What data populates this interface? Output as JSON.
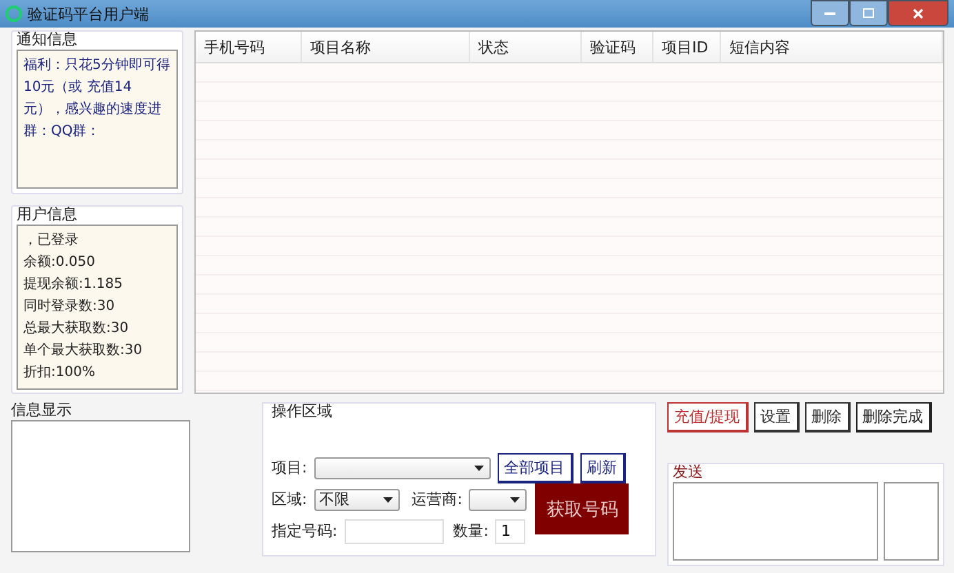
{
  "window": {
    "title": "验证码平台用户端"
  },
  "notice": {
    "label": "通知信息",
    "text": "福利：只花5分钟即可得10元（或 充值14元），感兴趣的速度进群：QQ群："
  },
  "user_info": {
    "label": "用户信息",
    "lines": [
      "，已登录",
      "余额:0.050",
      "提现余额:1.185",
      "同时登录数:30",
      "总最大获取数:30",
      "单个最大获取数:30",
      "折扣:100%"
    ]
  },
  "table": {
    "columns": [
      "手机号码",
      "项目名称",
      "状态",
      "验证码",
      "项目ID",
      "短信内容"
    ]
  },
  "message": {
    "label": "信息显示"
  },
  "operations": {
    "label": "操作区域",
    "project_label": "项目:",
    "all_projects": "全部项目",
    "refresh": "刷新",
    "region_label": "区域:",
    "region_value": "不限",
    "carrier_label": "运营商:",
    "number_label": "指定号码:",
    "count_label": "数量:",
    "count_value": "1",
    "get_number": "获取号码"
  },
  "actions": [
    {
      "label": "充值/提现",
      "kind": "accent"
    },
    {
      "label": "设置",
      "kind": "plain"
    },
    {
      "label": "删除",
      "kind": "plain"
    },
    {
      "label": "删除完成",
      "kind": "dark"
    }
  ],
  "send": {
    "label": "发送"
  }
}
